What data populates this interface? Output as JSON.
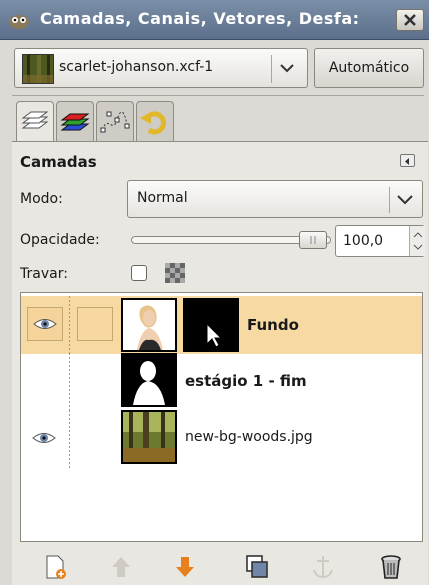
{
  "window": {
    "title": "Camadas, Canais, Vetores, Desfa:"
  },
  "image_selector": {
    "name": "scarlet-johanson.xcf-1"
  },
  "auto_button": {
    "label": "Automático"
  },
  "tabs": [
    {
      "name": "layers-tab",
      "icon": "layers-icon"
    },
    {
      "name": "channels-tab",
      "icon": "channels-icon"
    },
    {
      "name": "paths-tab",
      "icon": "paths-icon"
    },
    {
      "name": "undo-history-tab",
      "icon": "undo-icon"
    }
  ],
  "panel": {
    "title": "Camadas",
    "mode_label": "Modo:",
    "mode_value": "Normal",
    "opacity_label": "Opacidade:",
    "opacity_value": "100,0",
    "opacity_fraction": 1.0,
    "lock_label": "Travar:",
    "lock_pixels_checked": false
  },
  "layers": [
    {
      "name": "Fundo",
      "visible": true,
      "selected": true,
      "has_mask": true
    },
    {
      "name": "estágio 1 - fim",
      "visible": false,
      "selected": false,
      "has_mask": false
    },
    {
      "name": "new-bg-woods.jpg",
      "visible": true,
      "selected": false,
      "has_mask": false
    }
  ],
  "bottom_buttons": [
    {
      "name": "new-layer-button",
      "icon": "new-layer-icon",
      "enabled": true
    },
    {
      "name": "raise-layer-button",
      "icon": "arrow-up-icon",
      "enabled": false
    },
    {
      "name": "lower-layer-button",
      "icon": "arrow-down-icon",
      "enabled": true
    },
    {
      "name": "duplicate-layer-button",
      "icon": "duplicate-icon",
      "enabled": true
    },
    {
      "name": "anchor-layer-button",
      "icon": "anchor-icon",
      "enabled": false
    },
    {
      "name": "delete-layer-button",
      "icon": "trash-icon",
      "enabled": true
    }
  ],
  "colors": {
    "selected_row": "#f7d9a4",
    "titlebar": "#5b6f8b",
    "arrow_orange": "#e8801c"
  }
}
